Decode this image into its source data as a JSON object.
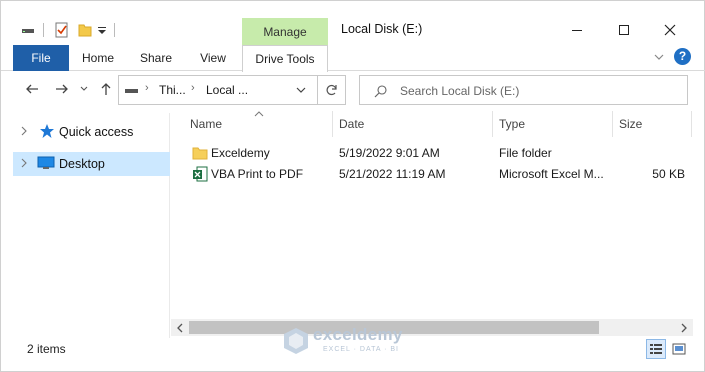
{
  "window": {
    "title": "Local Disk (E:)",
    "controls": {
      "minimize": "minimize",
      "maximize": "maximize",
      "close": "close"
    }
  },
  "ribbon": {
    "context_group": "Manage",
    "tabs": [
      {
        "label": "File"
      },
      {
        "label": "Home"
      },
      {
        "label": "Share"
      },
      {
        "label": "View"
      },
      {
        "label": "Drive Tools"
      }
    ],
    "help_label": "?"
  },
  "address": {
    "segments": [
      "Thi...",
      "Local ..."
    ]
  },
  "search": {
    "placeholder": "Search Local Disk (E:)"
  },
  "nav_pane": {
    "items": [
      {
        "label": "Quick access",
        "icon": "star-icon"
      },
      {
        "label": "Desktop",
        "icon": "desktop-icon",
        "selected": true
      }
    ]
  },
  "columns": [
    "Name",
    "Date",
    "Type",
    "Size"
  ],
  "files": [
    {
      "name": "Exceldemy",
      "date": "5/19/2022 9:01 AM",
      "type": "File folder",
      "size": "",
      "icon": "folder-icon"
    },
    {
      "name": "VBA Print to PDF",
      "date": "5/21/2022 11:19 AM",
      "type": "Microsoft Excel M...",
      "size": "50 KB",
      "icon": "excel-file-icon"
    }
  ],
  "status": {
    "item_count": "2 items"
  },
  "watermark": {
    "name": "exceldemy",
    "tagline": "EXCEL · DATA · BI"
  },
  "colors": {
    "file_tab": "#1f5fa8",
    "manage": "#c7ebab",
    "selection": "#cce8ff",
    "help": "#1f6fc4"
  }
}
